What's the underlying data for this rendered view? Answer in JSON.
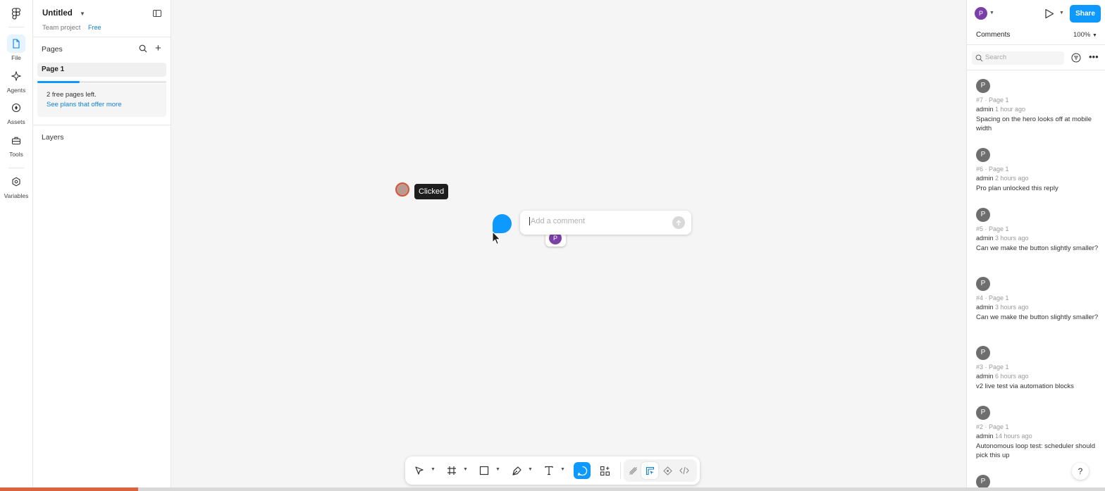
{
  "rail": {
    "items": [
      {
        "label": "File",
        "icon": "file-icon"
      },
      {
        "label": "Agents",
        "icon": "agents-icon"
      },
      {
        "label": "Assets",
        "icon": "assets-icon"
      },
      {
        "label": "Tools",
        "icon": "tools-icon"
      },
      {
        "label": "Variables",
        "icon": "variables-icon"
      }
    ]
  },
  "file": {
    "title": "Untitled",
    "team": "Team project",
    "plan": "Free"
  },
  "pages": {
    "label": "Pages",
    "items": [
      {
        "label": "Page 1"
      }
    ],
    "progress_fraction": 0.33,
    "free_notice": "2 free pages left.",
    "upgrade_link": "See plans that offer more"
  },
  "layers": {
    "label": "Layers"
  },
  "canvas": {
    "tooltip": "Clicked",
    "comment_placeholder": "Add a comment",
    "mini_avatar_initial": "P"
  },
  "right": {
    "avatar_initial": "P",
    "share_label": "Share",
    "tab_label": "Comments",
    "zoom": "100%",
    "search_placeholder": "Search",
    "comments": [
      {
        "initial": "P",
        "meta": "#7 · Page 1",
        "user": "admin",
        "time": "1 hour ago",
        "text": "Spacing on the hero looks off at mobile width"
      },
      {
        "initial": "P",
        "meta": "#6 · Page 1",
        "user": "admin",
        "time": "2 hours ago",
        "text": "Pro plan unlocked this reply"
      },
      {
        "initial": "P",
        "meta": "#5 · Page 1",
        "user": "admin",
        "time": "3 hours ago",
        "text": "Can we make the button slightly smaller?"
      },
      {
        "initial": "P",
        "meta": "#4 · Page 1",
        "user": "admin",
        "time": "3 hours ago",
        "text": "Can we make the button slightly smaller?"
      },
      {
        "initial": "P",
        "meta": "#3 · Page 1",
        "user": "admin",
        "time": "6 hours ago",
        "text": "v2 live test via automation blocks"
      },
      {
        "initial": "P",
        "meta": "#2 · Page 1",
        "user": "admin",
        "time": "14 hours ago",
        "text": "Autonomous loop test: scheduler should pick this up"
      },
      {
        "initial": "P",
        "meta": "",
        "user": "",
        "time": "",
        "text": ""
      }
    ],
    "help_label": "?"
  },
  "colors": {
    "accent": "#0d99ff",
    "avatar_purple": "#7b3fa8",
    "avatar_gray": "#6e6e6e",
    "canvas_bg": "#f5f5f5"
  }
}
